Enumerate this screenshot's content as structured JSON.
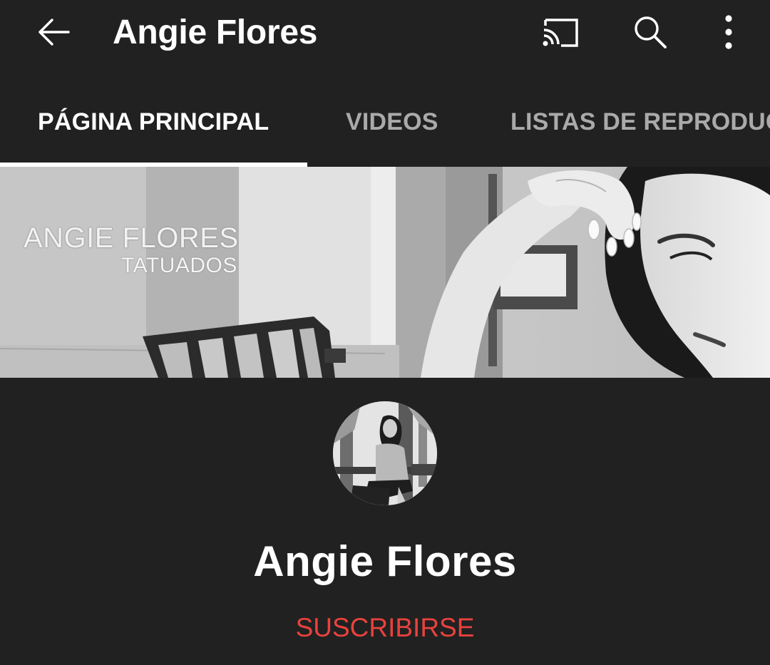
{
  "appbar": {
    "title": "Angie Flores",
    "icons": [
      "arrow-back-icon",
      "cast-icon",
      "search-icon",
      "more-vert-icon"
    ]
  },
  "tabs": [
    {
      "label": "PÁGINA PRINCIPAL",
      "active": true
    },
    {
      "label": "VIDEOS",
      "active": false
    },
    {
      "label": "LISTAS DE REPRODUC",
      "active": false
    }
  ],
  "banner": {
    "title": "ANGIE FLORES",
    "subtitle": "TATUADOS"
  },
  "channel": {
    "name": "Angie Flores",
    "subscribe_label": "SUSCRIBIRSE"
  },
  "colors": {
    "background": "#212121",
    "text_primary": "#ffffff",
    "tab_inactive": "#aaaaaa",
    "subscribe": "#e8423e"
  }
}
